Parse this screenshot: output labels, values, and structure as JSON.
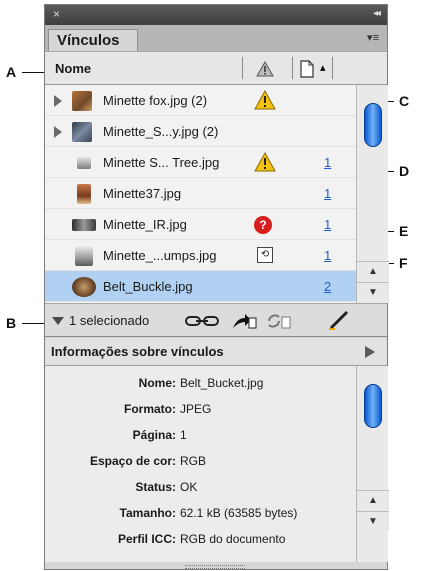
{
  "panel": {
    "close_glyph": "×",
    "collapse_glyph": "◂◂",
    "tab_label": "Vínculos",
    "tab_menu_glyph": "▾≡"
  },
  "columns": {
    "name_header": "Nome",
    "status_icon": "warning-triangle-icon",
    "page_icon": "page-icon",
    "sort_glyph": "▴"
  },
  "links": [
    {
      "name": "Minette fox.jpg (2)",
      "page": "",
      "status": "warning",
      "expandable": true
    },
    {
      "name": "Minette_S...y.jpg (2)",
      "page": "",
      "status": "",
      "expandable": true
    },
    {
      "name": "Minette S... Tree.jpg",
      "page": "1",
      "status": "warning",
      "expandable": false
    },
    {
      "name": "Minette37.jpg",
      "page": "1",
      "status": "",
      "expandable": false
    },
    {
      "name": "Minette_IR.jpg",
      "page": "1",
      "status": "missing",
      "expandable": false
    },
    {
      "name": "Minette_...umps.jpg",
      "page": "1",
      "status": "modified",
      "expandable": false
    },
    {
      "name": "Belt_Buckle.jpg",
      "page": "2",
      "status": "",
      "expandable": false,
      "selected": true
    }
  ],
  "status_bar": {
    "selected_text": "1 selecionado",
    "icons": [
      "relink-icon",
      "goto-link-icon",
      "update-link-icon",
      "edit-original-icon"
    ]
  },
  "info": {
    "header": "Informações sobre vínculos",
    "fields": [
      {
        "key": "Nome:",
        "value": "Belt_Bucket.jpg"
      },
      {
        "key": "Formato:",
        "value": "JPEG"
      },
      {
        "key": "Página:",
        "value": "1"
      },
      {
        "key": "Espaço de cor:",
        "value": "RGB"
      },
      {
        "key": "Status:",
        "value": "OK"
      },
      {
        "key": "Tamanho:",
        "value": "62.1 kB (63585 bytes)"
      },
      {
        "key": "Perfil ICC:",
        "value": "RGB do documento"
      }
    ]
  },
  "callouts": [
    "A",
    "B",
    "C",
    "D",
    "E",
    "F"
  ],
  "colors": {
    "selection": "#b1d1f2",
    "scroll_thumb": "#0a58d3",
    "link_page": "#1f5fc6",
    "missing": "#d81e1e",
    "warning": "#f2c20e"
  }
}
